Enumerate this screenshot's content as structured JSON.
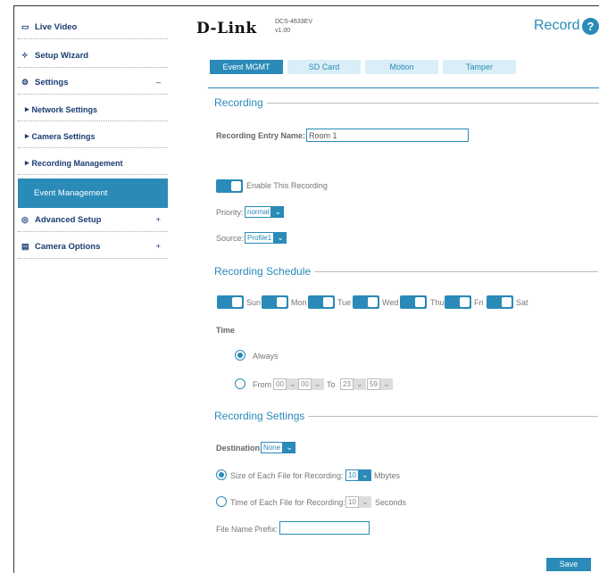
{
  "sidebar": {
    "items": [
      {
        "label": "Live Video",
        "icon": "video-icon"
      },
      {
        "label": "Setup Wizard",
        "icon": "wand-icon"
      },
      {
        "label": "Settings",
        "icon": "gear-icon",
        "toggle": "–"
      },
      {
        "label": "Network Settings"
      },
      {
        "label": "Camera Settings"
      },
      {
        "label": "Recording Management"
      },
      {
        "label": "Event Management"
      },
      {
        "label": "Advanced Setup",
        "icon": "advanced-icon",
        "toggle": "+"
      },
      {
        "label": "Camera Options",
        "icon": "camera-options-icon",
        "toggle": "+"
      }
    ]
  },
  "header": {
    "brand": "D-Link",
    "model": "DCS-4633EV",
    "version": "v1.00",
    "page_title": "Record",
    "help": "?"
  },
  "tabs": [
    "Event MGMT",
    "SD Card",
    "Motion",
    "Tamper"
  ],
  "recording": {
    "title": "Recording",
    "entry_name_label": "Recording Entry Name:",
    "entry_name_value": "Room 1",
    "enable_label": "Enable This Recording",
    "priority_label": "Priority:",
    "priority_value": "normal",
    "source_label": "Source:",
    "source_value": "Profile1"
  },
  "schedule": {
    "title": "Recording Schedule",
    "days": [
      "Sun",
      "Mon",
      "Tue",
      "Wed",
      "Thu",
      "Fri",
      "Sat"
    ],
    "time_label": "Time",
    "always_label": "Always",
    "from_label": "From",
    "from_hour": "00",
    "from_min": "00",
    "to_label": "To",
    "to_hour": "23",
    "to_min": "59"
  },
  "settings": {
    "title": "Recording Settings",
    "destination_label": "Destination",
    "destination_value": "None",
    "size_label": "Size of Each File for Recording:",
    "size_value": "10",
    "size_unit": "Mbytes",
    "time_label": "Time of Each File for Recording:",
    "time_value": "10",
    "time_unit": "Seconds",
    "prefix_label": "File Name Prefix:",
    "prefix_value": ""
  },
  "save_label": "Save",
  "colors": {
    "accent": "#2a8ab8",
    "nav": "#1a3c73"
  }
}
